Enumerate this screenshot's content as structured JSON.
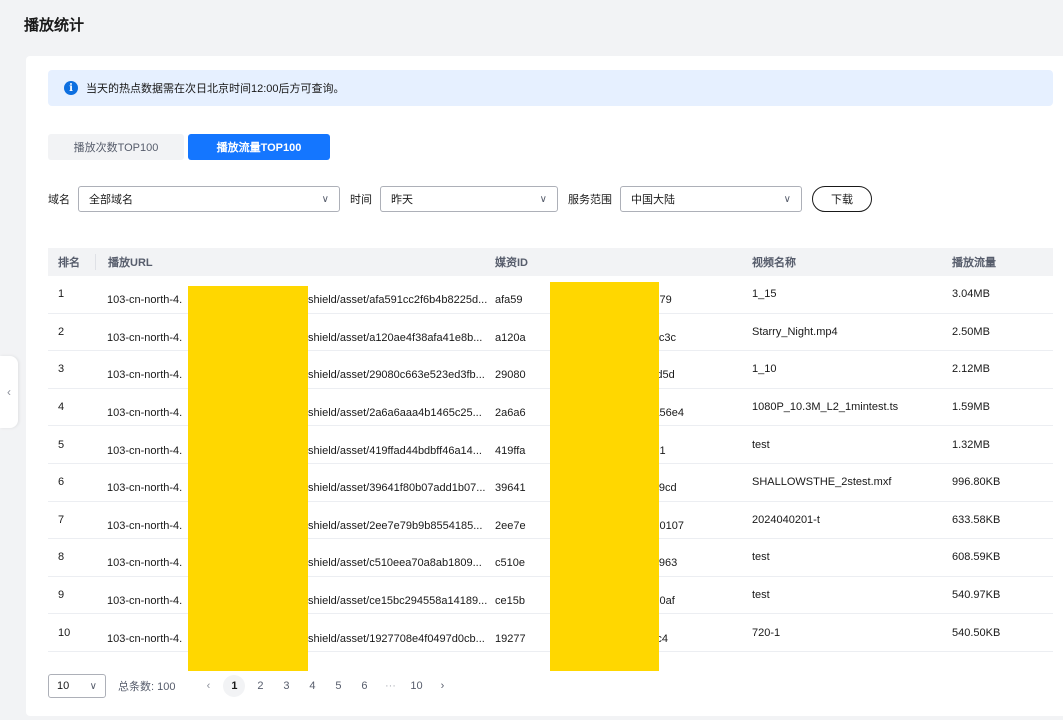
{
  "page": {
    "title": "播放统计"
  },
  "notice": {
    "text": "当天的热点数据需在次日北京时间12:00后方可查询。"
  },
  "tabs": [
    {
      "label": "播放次数TOP100",
      "active": false
    },
    {
      "label": "播放流量TOP100",
      "active": true
    }
  ],
  "filters": {
    "domain_label": "域名",
    "domain_value": "全部域名",
    "time_label": "时间",
    "time_value": "昨天",
    "scope_label": "服务范围",
    "scope_value": "中国大陆",
    "download_label": "下载"
  },
  "table": {
    "headers": [
      "排名",
      "播放URL",
      "媒资ID",
      "视频名称",
      "播放流量"
    ],
    "rows": [
      {
        "rank": "1",
        "url_prefix": "103-cn-north-4.",
        "url_suffix": "/shield/asset/afa591cc2f6b4b8225d...",
        "media_prefix": "afa59",
        "media_suffix": "309679",
        "name": "1_15",
        "traffic": "3.04MB"
      },
      {
        "rank": "2",
        "url_prefix": "103-cn-north-4.",
        "url_suffix": "/shield/asset/a120ae4f38afa41e8b...",
        "media_prefix": "a120a",
        "media_suffix": "7c84c3c",
        "name": "Starry_Night.mp4",
        "traffic": "2.50MB"
      },
      {
        "rank": "3",
        "url_prefix": "103-cn-north-4.",
        "url_suffix": "/shield/asset/29080c663e523ed3fb...",
        "media_prefix": "29080",
        "media_suffix": "32afd5d",
        "name": "1_10",
        "traffic": "2.12MB"
      },
      {
        "rank": "4",
        "url_prefix": "103-cn-north-4.",
        "url_suffix": "/shield/asset/2a6a6aaa4b1465c25...",
        "media_prefix": "2a6a6",
        "media_suffix": "108a56e4",
        "name": "1080P_10.3M_L2_1mintest.ts",
        "traffic": "1.59MB"
      },
      {
        "rank": "5",
        "url_prefix": "103-cn-north-4.",
        "url_suffix": "/shield/asset/419ffad44bdbff46a14...",
        "media_prefix": "419ffa",
        "media_suffix": "b8051",
        "name": "test",
        "traffic": "1.32MB"
      },
      {
        "rank": "6",
        "url_prefix": "103-cn-north-4.",
        "url_suffix": "/shield/asset/39641f80b07add1b07...",
        "media_prefix": "39641",
        "media_suffix": "1c599cd",
        "name": "SHALLOWSTHE_2stest.mxf",
        "traffic": "996.80KB"
      },
      {
        "rank": "7",
        "url_prefix": "103-cn-north-4.",
        "url_suffix": "/shield/asset/2ee7e79b9b8554185...",
        "media_prefix": "2ee7e",
        "media_suffix": "57920107",
        "name": "2024040201-t",
        "traffic": "633.58KB"
      },
      {
        "rank": "8",
        "url_prefix": "103-cn-north-4.",
        "url_suffix": "/shield/asset/c510eea70a8ab1809...",
        "media_prefix": "c510e",
        "media_suffix": "c325963",
        "name": "test",
        "traffic": "608.59KB"
      },
      {
        "rank": "9",
        "url_prefix": "103-cn-north-4.",
        "url_suffix": "/shield/asset/ce15bc294558a14189...",
        "media_prefix": "ce15b",
        "media_suffix": "7dde0af",
        "name": "test",
        "traffic": "540.97KB"
      },
      {
        "rank": "10",
        "url_prefix": "103-cn-north-4.",
        "url_suffix": "/shield/asset/1927708e4f0497d0cb...",
        "media_prefix": "19277",
        "media_suffix": "7bafc4",
        "name": "720-1",
        "traffic": "540.50KB"
      }
    ]
  },
  "pagination": {
    "page_size": "10",
    "total_label": "总条数: 100",
    "pages": [
      "1",
      "2",
      "3",
      "4",
      "5",
      "6",
      "···",
      "10"
    ],
    "current": "1"
  },
  "colors": {
    "primary": "#1476ff",
    "notice_bg": "#e6f0ff",
    "mask": "#ffd700"
  },
  "icons": {
    "info": "info-icon",
    "chevron": "chevron-down-icon",
    "collapse": "chevron-left-icon"
  }
}
